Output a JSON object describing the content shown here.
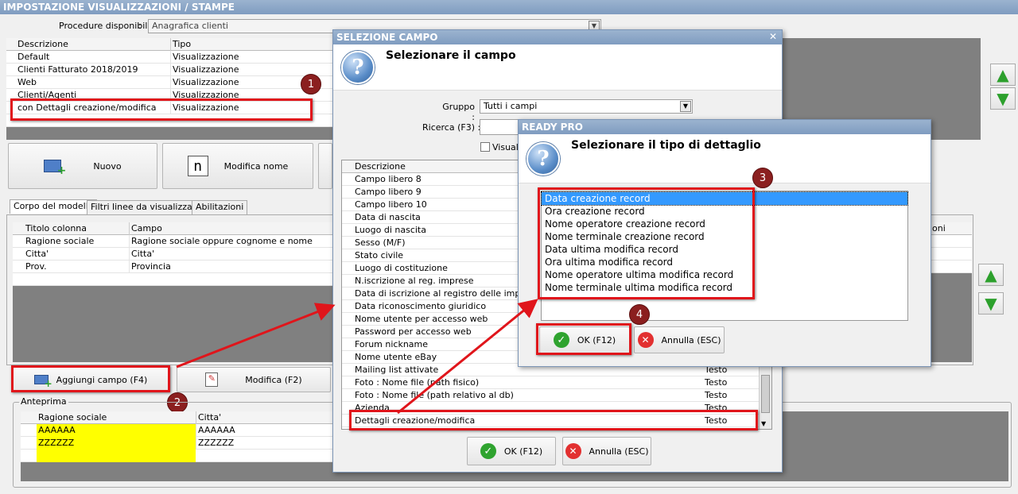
{
  "main": {
    "title": "IMPOSTAZIONE VISUALIZZAZIONI / STAMPE",
    "procedure_label": "Procedure disponibili",
    "procedure_value": "Anagrafica clienti",
    "list_headers": [
      "Descrizione",
      "Tipo"
    ],
    "list_rows": [
      [
        "Default",
        "Visualizzazione"
      ],
      [
        "Clienti Fatturato 2018/2019",
        "Visualizzazione"
      ],
      [
        "Web",
        "Visualizzazione"
      ],
      [
        "Clienti/Agenti",
        "Visualizzazione"
      ],
      [
        "con Dettagli creazione/modifica",
        "Visualizzazione"
      ]
    ],
    "new_label": "Nuovo",
    "rename_label": "Modifica nome",
    "tabs": [
      "Corpo del modello",
      "Filtri linee da visualizzare",
      "Abilitazioni"
    ],
    "body_headers": [
      "Titolo colonna",
      "Campo"
    ],
    "body_rows": [
      [
        "Ragione sociale",
        "Ragione sociale oppure cognome e nome"
      ],
      [
        "Citta'",
        "Citta'"
      ],
      [
        "Prov.",
        "Provincia"
      ]
    ],
    "right_header_fragment": "oni",
    "add_field_label": "Aggiungi campo (F4)",
    "edit_label": "Modifica (F2)",
    "preview_label": "Anteprima",
    "preview_headers": [
      "Ragione sociale",
      "Citta'"
    ],
    "preview_rows": [
      [
        "AAAAAA",
        "AAAAAA"
      ],
      [
        "ZZZZZZ",
        "ZZZZZZ"
      ]
    ]
  },
  "select_field": {
    "title": "SELEZIONE CAMPO",
    "heading": "Selezionare il campo",
    "group_label": "Gruppo :",
    "group_value": "Tutti i campi",
    "search_label": "Ricerca (F3) :",
    "checkbox_label": "Visuali",
    "header": "Descrizione",
    "rows": [
      [
        "Campo libero 8",
        ""
      ],
      [
        "Campo libero 9",
        ""
      ],
      [
        "Campo libero 10",
        ""
      ],
      [
        "Data di nascita",
        ""
      ],
      [
        "Luogo di nascita",
        ""
      ],
      [
        "Sesso (M/F)",
        ""
      ],
      [
        "Stato civile",
        ""
      ],
      [
        "Luogo di costituzione",
        ""
      ],
      [
        "N.iscrizione al reg. imprese",
        ""
      ],
      [
        "Data di iscrizione al registro delle imprese",
        ""
      ],
      [
        "Data riconoscimento giuridico",
        ""
      ],
      [
        "Nome utente per accesso web",
        ""
      ],
      [
        "Password per accesso web",
        ""
      ],
      [
        "Forum nickname",
        ""
      ],
      [
        "Nome utente eBay",
        ""
      ],
      [
        "Mailing list attivate",
        "Testo"
      ],
      [
        "Foto : Nome file (path fisico)",
        "Testo"
      ],
      [
        "Foto : Nome file (path relativo al db)",
        "Testo"
      ],
      [
        "Azienda",
        "Testo"
      ],
      [
        "Dettagli creazione/modifica",
        "Testo"
      ]
    ],
    "ok_label": "OK (F12)",
    "cancel_label": "Annulla (ESC)"
  },
  "ready_pro": {
    "title": "READY PRO",
    "heading": "Selezionare il tipo di dettaglio",
    "options": [
      "Data creazione record",
      "Ora creazione record",
      "Nome operatore creazione record",
      "Nome terminale creazione record",
      "Data ultima modifica record",
      "Ora ultima modifica record",
      "Nome operatore ultima modifica record",
      "Nome terminale ultima modifica record"
    ],
    "ok_label": "OK (F12)",
    "cancel_label": "Annulla (ESC)"
  },
  "badges": [
    "1",
    "2",
    "3",
    "4"
  ],
  "colors": {
    "highlight": "#e0151b",
    "selection": "#3399ff",
    "preview_yellow": "#ffff00"
  }
}
